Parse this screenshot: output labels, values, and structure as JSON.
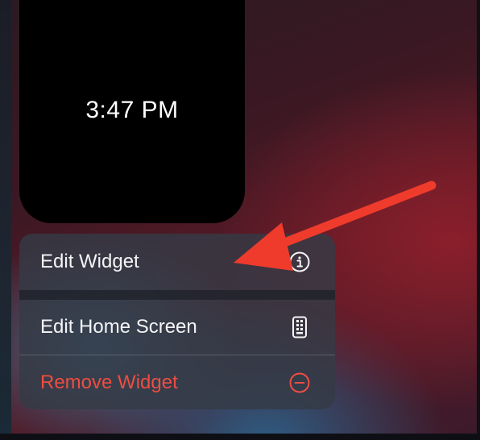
{
  "widget": {
    "time": "3:47 PM"
  },
  "context_menu": {
    "items": [
      {
        "label": "Edit Widget",
        "icon": "info-circle-icon",
        "style": "default"
      },
      {
        "label": "Edit Home Screen",
        "icon": "phone-apps-icon",
        "style": "default"
      },
      {
        "label": "Remove Widget",
        "icon": "minus-circle-icon",
        "style": "destructive"
      }
    ]
  },
  "annotation": {
    "type": "arrow",
    "color": "#ef3b2c",
    "points_to": "Edit Widget"
  },
  "colors": {
    "menu_background": "#343a46",
    "destructive": "#ee4d42",
    "text": "#f4f4f6"
  }
}
